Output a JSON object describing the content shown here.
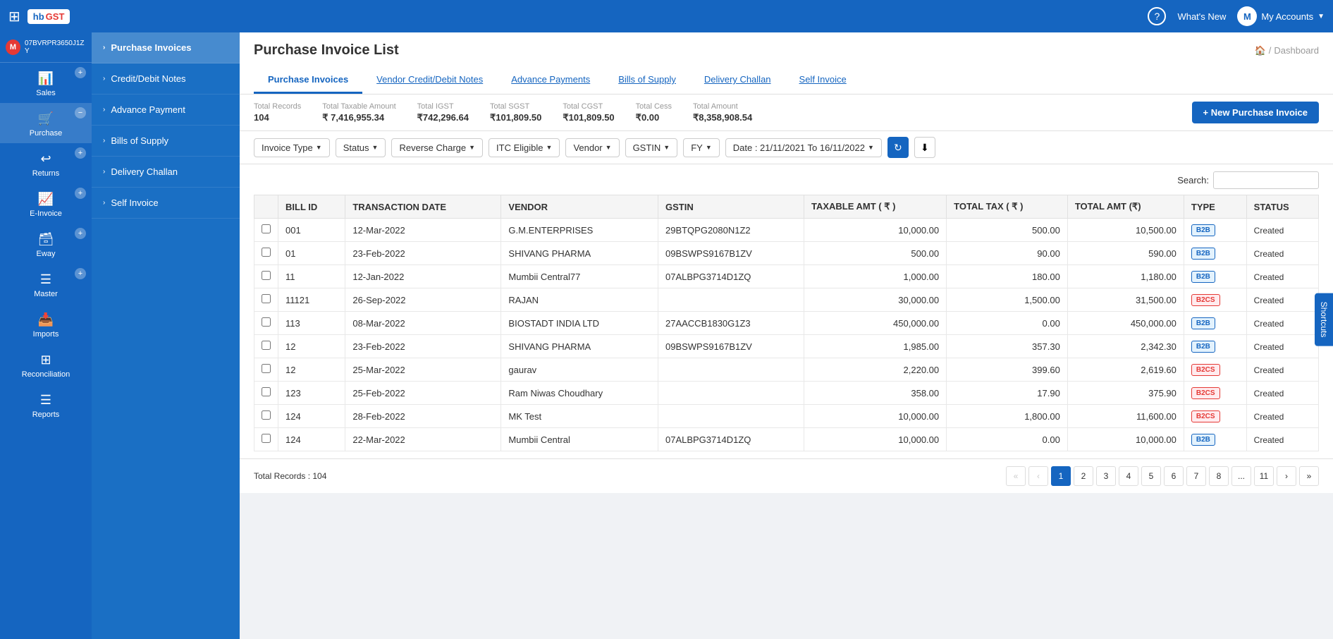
{
  "topnav": {
    "whats_new": "What's New",
    "my_accounts": "My Accounts",
    "avatar": "M"
  },
  "sidebar_user": {
    "id": "07BVRPR3650J1ZY",
    "avatar": "M"
  },
  "sidebar": {
    "items": [
      {
        "label": "Sales",
        "icon": "📊",
        "plus": true,
        "minus": false
      },
      {
        "label": "Purchase",
        "icon": "🛒",
        "plus": false,
        "minus": true,
        "active": true
      },
      {
        "label": "Returns",
        "icon": "↩",
        "plus": true,
        "minus": false
      },
      {
        "label": "E-Invoice",
        "icon": "📈",
        "plus": true,
        "minus": false
      },
      {
        "label": "Eway",
        "icon": "🗃",
        "plus": true,
        "minus": false
      },
      {
        "label": "Master",
        "icon": "☰",
        "plus": true,
        "minus": false
      },
      {
        "label": "Imports",
        "icon": "📥",
        "plus": false,
        "minus": false
      },
      {
        "label": "Reconciliation",
        "icon": "⊞",
        "plus": false,
        "minus": false
      },
      {
        "label": "Reports",
        "icon": "☰",
        "plus": false,
        "minus": false
      }
    ]
  },
  "submenu": {
    "items": [
      {
        "label": "Purchase Invoices",
        "active": true
      },
      {
        "label": "Credit/Debit Notes",
        "active": false
      },
      {
        "label": "Advance Payment",
        "active": false
      },
      {
        "label": "Bills of Supply",
        "active": false
      },
      {
        "label": "Delivery Challan",
        "active": false
      },
      {
        "label": "Self Invoice",
        "active": false
      }
    ]
  },
  "page": {
    "title": "Purchase Invoice List",
    "breadcrumb_home": "🏠",
    "breadcrumb_separator": "/",
    "breadcrumb_page": "Dashboard"
  },
  "tabs": [
    {
      "label": "Purchase Invoices",
      "active": true
    },
    {
      "label": "Vendor Credit/Debit Notes",
      "active": false
    },
    {
      "label": "Advance Payments",
      "active": false
    },
    {
      "label": "Bills of Supply",
      "active": false
    },
    {
      "label": "Delivery Challan",
      "active": false
    },
    {
      "label": "Self Invoice",
      "active": false
    }
  ],
  "stats": {
    "total_records_label": "Total Records",
    "total_records_value": "104",
    "taxable_amount_label": "Total Taxable Amount",
    "taxable_amount_value": "₹ 7,416,955.34",
    "igst_label": "Total IGST",
    "igst_value": "₹742,296.64",
    "sgst_label": "Total SGST",
    "sgst_value": "₹101,809.50",
    "cgst_label": "Total CGST",
    "cgst_value": "₹101,809.50",
    "cess_label": "Total Cess",
    "cess_value": "₹0.00",
    "total_amount_label": "Total Amount",
    "total_amount_value": "₹8,358,908.54",
    "new_invoice_btn": "+ New Purchase Invoice"
  },
  "filters": {
    "invoice_type": "Invoice Type",
    "status": "Status",
    "reverse_charge": "Reverse Charge",
    "itc_eligible": "ITC Eligible",
    "vendor": "Vendor",
    "gstin": "GSTIN",
    "fy": "FY",
    "date_range": "Date : 21/11/2021 To 16/11/2022"
  },
  "search": {
    "label": "Search:",
    "placeholder": ""
  },
  "table": {
    "columns": [
      "",
      "BILL ID",
      "TRANSACTION DATE",
      "VENDOR",
      "GSTIN",
      "TAXABLE AMT ( ₹ )",
      "TOTAL TAX ( ₹ )",
      "TOTAL AMT (₹)",
      "TYPE",
      "STATUS"
    ],
    "rows": [
      {
        "checkbox": false,
        "bill_id": "001",
        "date": "12-Mar-2022",
        "vendor": "G.M.ENTERPRISES",
        "gstin": "29BTQPG2080N1Z2",
        "taxable": "10,000.00",
        "tax": "500.00",
        "total": "10,500.00",
        "type": "B2B",
        "status": "Created"
      },
      {
        "checkbox": false,
        "bill_id": "01",
        "date": "23-Feb-2022",
        "vendor": "SHIVANG PHARMA",
        "gstin": "09BSWPS9167B1ZV",
        "taxable": "500.00",
        "tax": "90.00",
        "total": "590.00",
        "type": "B2B",
        "status": "Created"
      },
      {
        "checkbox": false,
        "bill_id": "11",
        "date": "12-Jan-2022",
        "vendor": "Mumbii Central77",
        "gstin": "07ALBPG3714D1ZQ",
        "taxable": "1,000.00",
        "tax": "180.00",
        "total": "1,180.00",
        "type": "B2B",
        "status": "Created"
      },
      {
        "checkbox": false,
        "bill_id": "11121",
        "date": "26-Sep-2022",
        "vendor": "RAJAN",
        "gstin": "",
        "taxable": "30,000.00",
        "tax": "1,500.00",
        "total": "31,500.00",
        "type": "B2CS",
        "status": "Created"
      },
      {
        "checkbox": false,
        "bill_id": "113",
        "date": "08-Mar-2022",
        "vendor": "BIOSTADT INDIA LTD",
        "gstin": "27AACCB1830G1Z3",
        "taxable": "450,000.00",
        "tax": "0.00",
        "total": "450,000.00",
        "type": "B2B",
        "status": "Created"
      },
      {
        "checkbox": false,
        "bill_id": "12",
        "date": "23-Feb-2022",
        "vendor": "SHIVANG PHARMA",
        "gstin": "09BSWPS9167B1ZV",
        "taxable": "1,985.00",
        "tax": "357.30",
        "total": "2,342.30",
        "type": "B2B",
        "status": "Created"
      },
      {
        "checkbox": false,
        "bill_id": "12",
        "date": "25-Mar-2022",
        "vendor": "gaurav",
        "gstin": "",
        "taxable": "2,220.00",
        "tax": "399.60",
        "total": "2,619.60",
        "type": "B2CS",
        "status": "Created"
      },
      {
        "checkbox": false,
        "bill_id": "123",
        "date": "25-Feb-2022",
        "vendor": "Ram Niwas Choudhary",
        "gstin": "",
        "taxable": "358.00",
        "tax": "17.90",
        "total": "375.90",
        "type": "B2CS",
        "status": "Created"
      },
      {
        "checkbox": false,
        "bill_id": "124",
        "date": "28-Feb-2022",
        "vendor": "MK Test",
        "gstin": "",
        "taxable": "10,000.00",
        "tax": "1,800.00",
        "total": "11,600.00",
        "type": "B2CS",
        "status": "Created"
      },
      {
        "checkbox": false,
        "bill_id": "124",
        "date": "22-Mar-2022",
        "vendor": "Mumbii Central",
        "gstin": "07ALBPG3714D1ZQ",
        "taxable": "10,000.00",
        "tax": "0.00",
        "total": "10,000.00",
        "type": "B2B",
        "status": "Created"
      }
    ]
  },
  "pagination": {
    "total_records": "Total Records : 104",
    "pages": [
      "«",
      "‹",
      "1",
      "2",
      "3",
      "4",
      "5",
      "6",
      "7",
      "8",
      "...",
      "11",
      "›",
      "»"
    ]
  },
  "shortcuts_label": "Shortcuts"
}
